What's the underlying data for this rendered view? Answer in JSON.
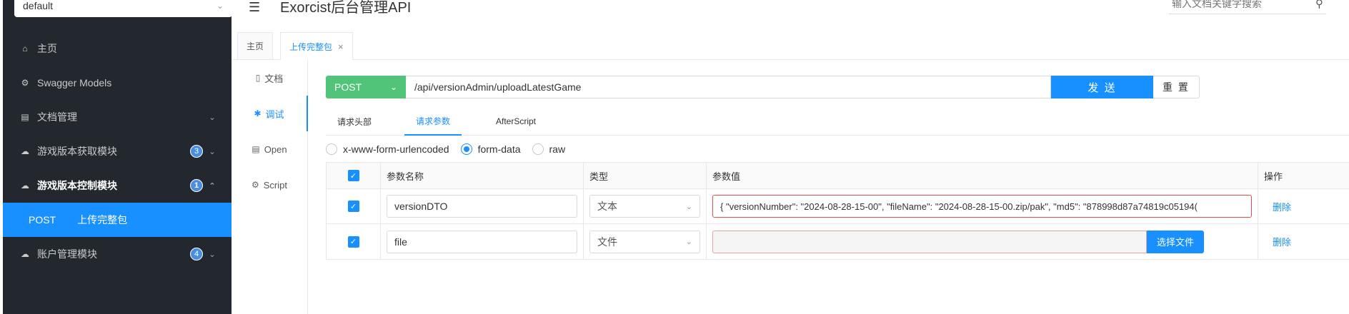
{
  "sidebar": {
    "group_select": "default",
    "items": [
      {
        "label": "主页",
        "icon": "home-icon",
        "glyph": "⌂"
      },
      {
        "label": "Swagger Models",
        "icon": "models-icon",
        "glyph": "⚙"
      },
      {
        "label": "文档管理",
        "icon": "doc-manage-icon",
        "glyph": "▤"
      },
      {
        "label": "游戏版本获取模块",
        "icon": "cloud-icon",
        "glyph": "☁",
        "badge": "3"
      },
      {
        "label": "游戏版本控制模块",
        "icon": "cloud-icon",
        "glyph": "☁",
        "badge": "1"
      },
      {
        "method": "POST",
        "label": "上传完整包"
      },
      {
        "label": "账户管理模块",
        "icon": "cloud-icon",
        "glyph": "☁",
        "badge": "4"
      }
    ]
  },
  "header": {
    "title": "Exorcist后台管理API",
    "search_placeholder": "输入文档关键字搜索"
  },
  "tabs": [
    {
      "label": "主页"
    },
    {
      "label": "上传完整包"
    }
  ],
  "subnav": [
    {
      "label": "文档",
      "glyph": "▯"
    },
    {
      "label": "调试",
      "glyph": "✱"
    },
    {
      "label": "Open",
      "glyph": "▤"
    },
    {
      "label": "Script",
      "glyph": "⚙"
    }
  ],
  "request": {
    "method": "POST",
    "url": "/api/versionAdmin/uploadLatestGame",
    "send_label": "发 送",
    "reset_label": "重 置"
  },
  "req_tabs": [
    {
      "label": "请求头部"
    },
    {
      "label": "请求参数"
    },
    {
      "label": "AfterScript"
    }
  ],
  "body_types": [
    {
      "label": "x-www-form-urlencoded",
      "checked": false
    },
    {
      "label": "form-data",
      "checked": true
    },
    {
      "label": "raw",
      "checked": false
    }
  ],
  "params": {
    "headers": {
      "name": "参数名称",
      "type": "类型",
      "value": "参数值",
      "op": "操作"
    },
    "rows": [
      {
        "name": "versionDTO",
        "type": "文本",
        "value": "{  \"versionNumber\": \"2024-08-28-15-00\",  \"fileName\": \"2024-08-28-15-00.zip/pak\",  \"md5\": \"878998d87a74819c05194(",
        "op": "删除"
      },
      {
        "name": "file",
        "type": "文件",
        "file_button": "选择文件",
        "op": "删除"
      }
    ]
  },
  "colors": {
    "sidebar_bg": "#22282e",
    "accent": "#1890ff",
    "post_method": "#52c47a"
  }
}
